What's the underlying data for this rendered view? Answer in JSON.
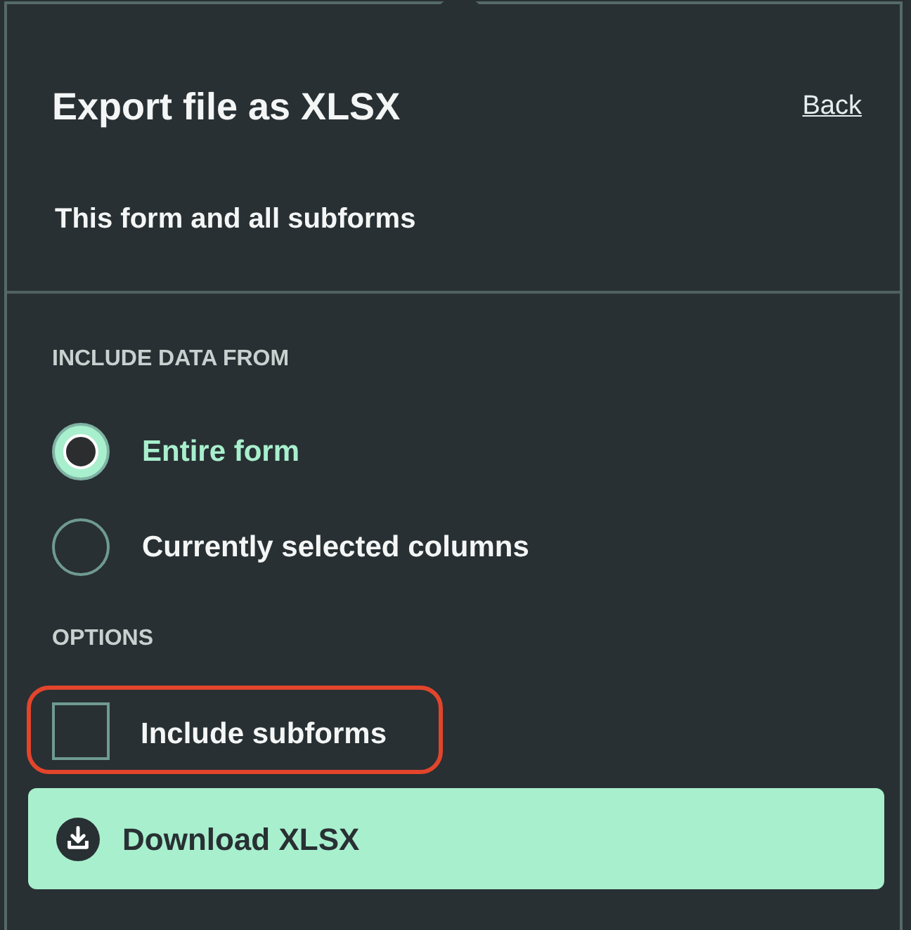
{
  "panel": {
    "title": "Export file as XLSX",
    "back_link": "Back",
    "scope": "This form and all subforms"
  },
  "include_data": {
    "heading": "INCLUDE DATA FROM",
    "choices": [
      {
        "label": "Entire form",
        "selected": true
      },
      {
        "label": "Currently selected columns",
        "selected": false
      }
    ]
  },
  "options": {
    "heading": "OPTIONS",
    "items": [
      {
        "label": "Include subforms",
        "checked": false,
        "highlighted": true
      }
    ]
  },
  "download_button": {
    "label": "Download XLSX"
  }
}
